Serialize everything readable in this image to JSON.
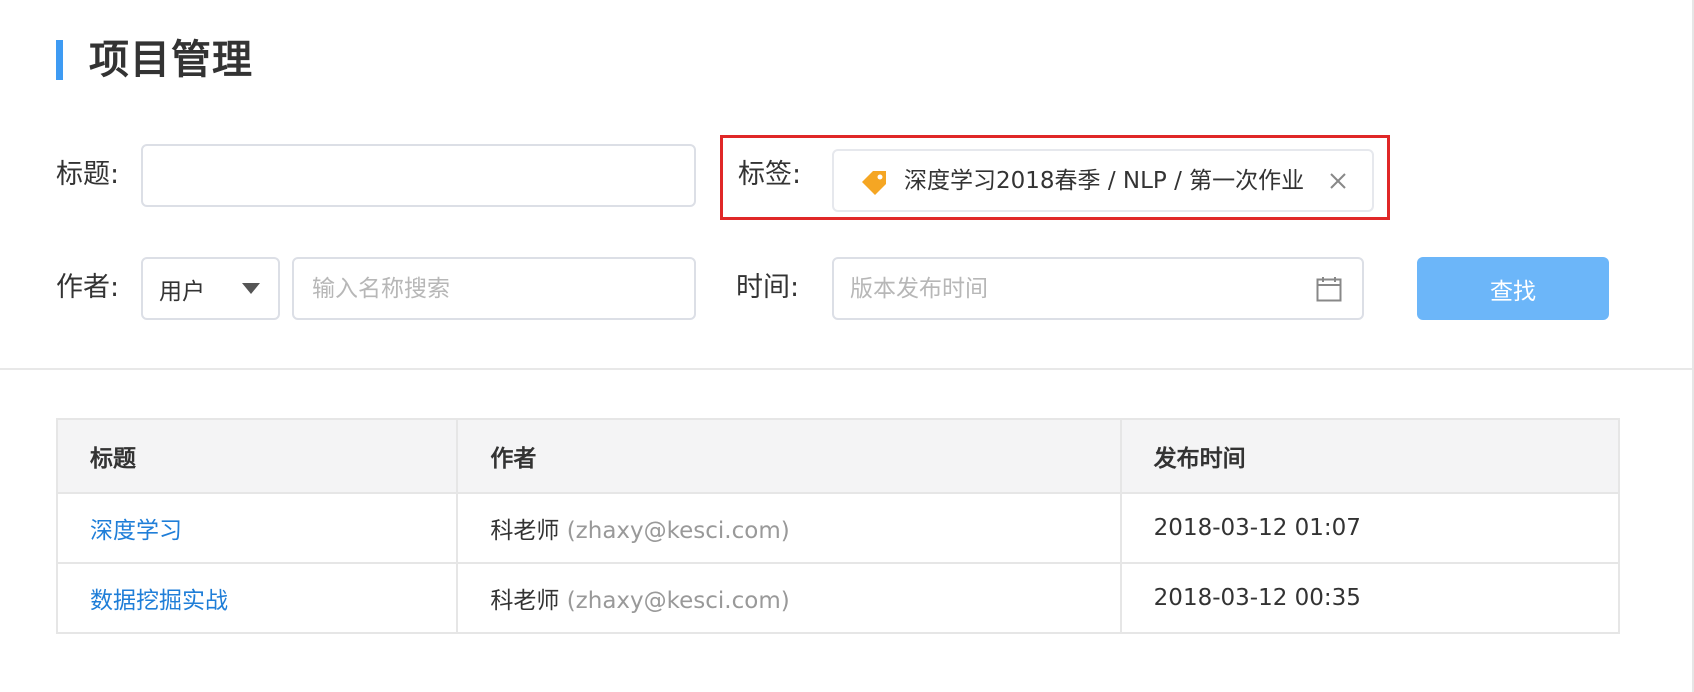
{
  "page": {
    "title": "项目管理"
  },
  "form": {
    "title_label": "标题:",
    "title_value": "",
    "tag_label": "标签:",
    "tag_value": "深度学习2018春季 / NLP / 第一次作业",
    "author_label": "作者:",
    "author_select_value": "用户",
    "author_search_placeholder": "输入名称搜索",
    "time_label": "时间:",
    "time_placeholder": "版本发布时间",
    "search_button": "查找"
  },
  "table": {
    "headers": [
      "标题",
      "作者",
      "发布时间"
    ],
    "rows": [
      {
        "title": "深度学习",
        "author": "科老师",
        "email": "(zhaxy@kesci.com)",
        "time": "2018-03-12 01:07"
      },
      {
        "title": "数据挖掘实战",
        "author": "科老师",
        "email": "(zhaxy@kesci.com)",
        "time": "2018-03-12 00:35"
      }
    ]
  },
  "colors": {
    "accent": "#3e9bf3",
    "button": "#6cb6f9",
    "link": "#1f7ed8",
    "highlight_border": "#e02828",
    "tag_icon": "#f5a623"
  },
  "icons": {
    "tag": "tag-icon",
    "close": "close-icon",
    "calendar": "calendar-icon",
    "dropdown": "chevron-down-icon"
  }
}
